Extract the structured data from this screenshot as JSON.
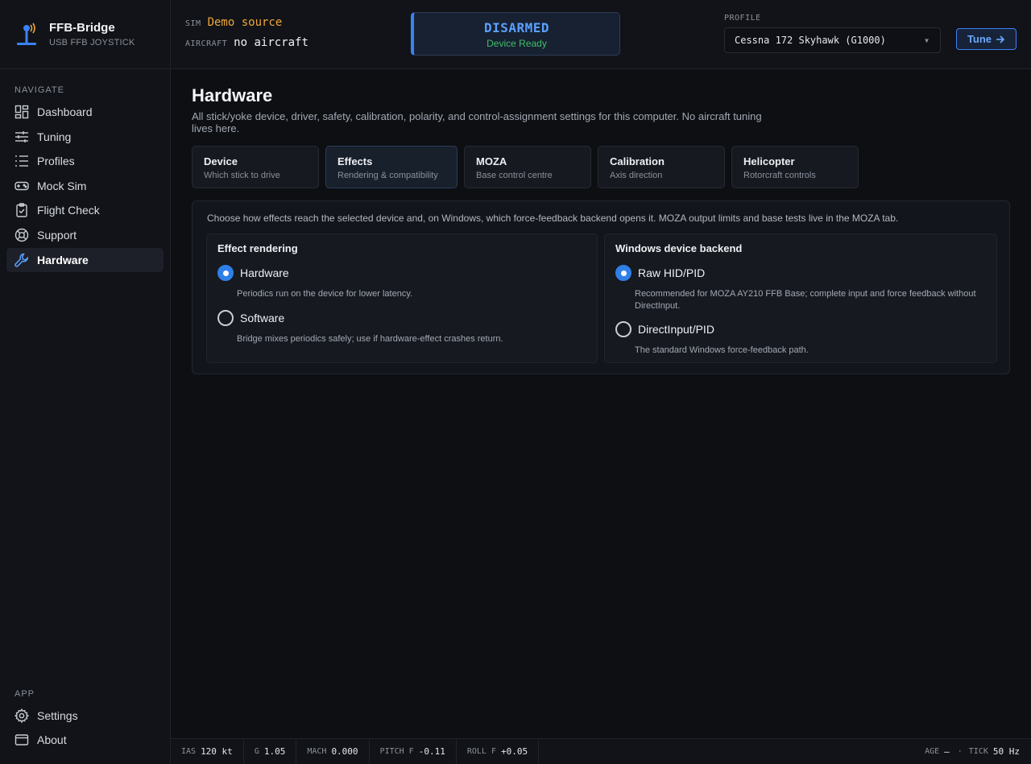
{
  "app": {
    "name": "FFB-Bridge",
    "subtitle": "USB FFB JOYSTICK"
  },
  "sidebar": {
    "navigate_label": "NAVIGATE",
    "items": [
      {
        "label": "Dashboard",
        "icon": "dashboard-icon"
      },
      {
        "label": "Tuning",
        "icon": "sliders-icon"
      },
      {
        "label": "Profiles",
        "icon": "list-icon"
      },
      {
        "label": "Mock Sim",
        "icon": "gamepad-icon"
      },
      {
        "label": "Flight Check",
        "icon": "clipboard-check-icon"
      },
      {
        "label": "Support",
        "icon": "lifebuoy-icon"
      },
      {
        "label": "Hardware",
        "icon": "wrench-icon",
        "active": true
      }
    ],
    "app_label": "APP",
    "app_items": [
      {
        "label": "Settings",
        "icon": "gear-icon"
      },
      {
        "label": "About",
        "icon": "window-icon"
      }
    ]
  },
  "topbar": {
    "sim_key": "SIM",
    "sim_value": "Demo source",
    "aircraft_key": "AIRCRAFT",
    "aircraft_value": "no aircraft",
    "arm_state": "DISARMED",
    "arm_sub": "Device Ready",
    "profile_label": "PROFILE",
    "profile_value": "Cessna 172 Skyhawk (G1000)",
    "tune_label": "Tune"
  },
  "page": {
    "title": "Hardware",
    "description": "All stick/yoke device, driver, safety, calibration, polarity, and control-assignment settings for this computer. No aircraft tuning lives here.",
    "tabs": [
      {
        "title": "Device",
        "sub": "Which stick to drive"
      },
      {
        "title": "Effects",
        "sub": "Rendering & compatibility",
        "active": true
      },
      {
        "title": "MOZA",
        "sub": "Base control centre"
      },
      {
        "title": "Calibration",
        "sub": "Axis direction"
      },
      {
        "title": "Helicopter",
        "sub": "Rotorcraft controls"
      }
    ],
    "panel_intro": "Choose how effects reach the selected device and, on Windows, which force-feedback backend opens it. MOZA output limits and base tests live in the MOZA tab.",
    "effect_rendering": {
      "title": "Effect rendering",
      "options": [
        {
          "label": "Hardware",
          "desc": "Periodics run on the device for lower latency.",
          "selected": true
        },
        {
          "label": "Software",
          "desc": "Bridge mixes periodics safely; use if hardware-effect crashes return.",
          "selected": false
        }
      ]
    },
    "windows_backend": {
      "title": "Windows device backend",
      "options": [
        {
          "label": "Raw HID/PID",
          "desc": "Recommended for MOZA AY210 FFB Base; complete input and force feedback without DirectInput.",
          "selected": true
        },
        {
          "label": "DirectInput/PID",
          "desc": "The standard Windows force-feedback path.",
          "selected": false
        }
      ]
    }
  },
  "statusbar": {
    "ias_key": "IAS",
    "ias_value": "120 kt",
    "g_key": "G",
    "g_value": "1.05",
    "mach_key": "MACH",
    "mach_value": "0.000",
    "pitch_key": "PITCH F",
    "pitch_value": "-0.11",
    "roll_key": "ROLL F",
    "roll_value": "+0.05",
    "age_key": "AGE",
    "age_value": "—",
    "dot": "·",
    "tick_key": "TICK",
    "tick_value": "50 Hz"
  },
  "colors": {
    "accent": "#3b82f6",
    "sim_value": "#f0a63a",
    "ready": "#3fbf6a",
    "background": "#0d0f13"
  }
}
